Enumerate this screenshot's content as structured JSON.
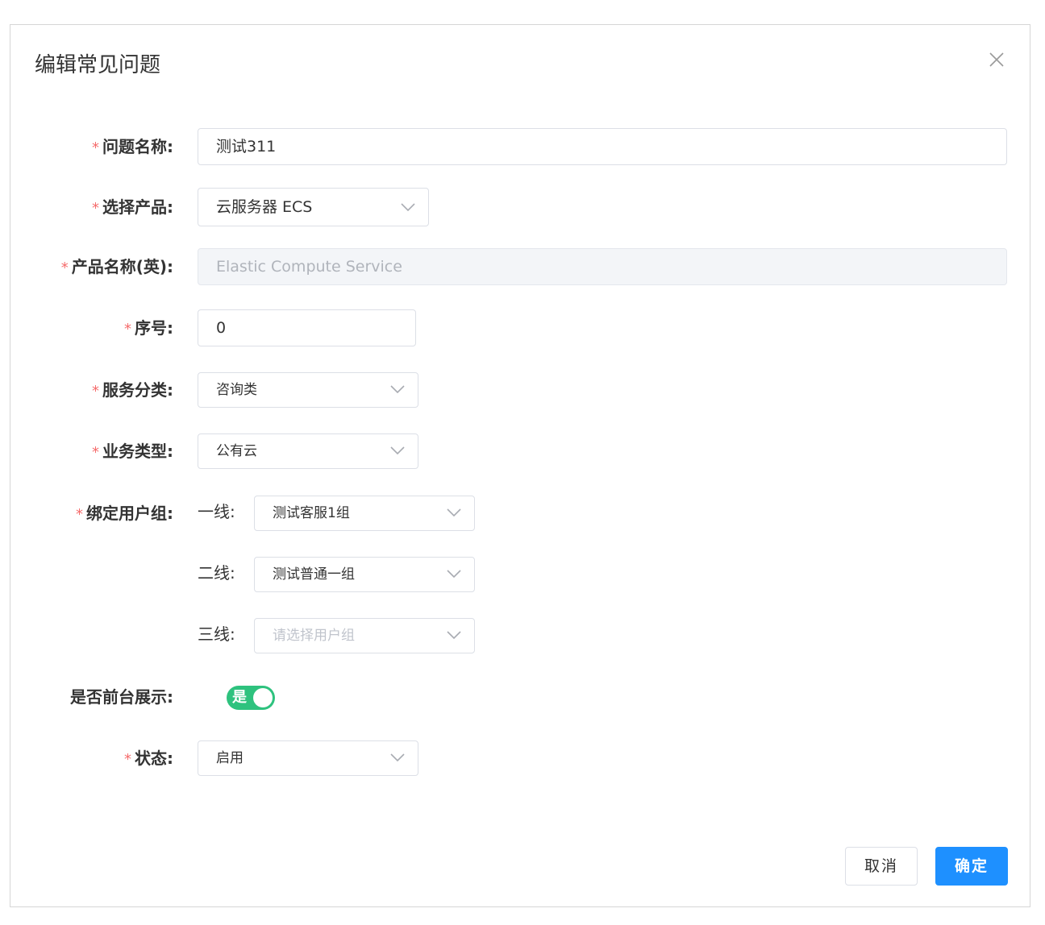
{
  "dialog": {
    "title": "编辑常见问题"
  },
  "fields": {
    "question_name": {
      "label": "问题名称:",
      "value": "测试311"
    },
    "product": {
      "label": "选择产品:",
      "value": "云服务器 ECS"
    },
    "product_en": {
      "label": "产品名称(英):",
      "value": "Elastic Compute Service"
    },
    "order": {
      "label": "序号:",
      "value": "0"
    },
    "service_category": {
      "label": "服务分类:",
      "value": "咨询类"
    },
    "business_type": {
      "label": "业务类型:",
      "value": "公有云"
    },
    "user_group": {
      "label": "绑定用户组:",
      "line1_label": "一线:",
      "line1_value": "测试客服1组",
      "line2_label": "二线:",
      "line2_value": "测试普通一组",
      "line3_label": "三线:",
      "line3_placeholder": "请选择用户组"
    },
    "show_front": {
      "label": "是否前台展示:",
      "switch_text": "是",
      "on": true
    },
    "status": {
      "label": "状态:",
      "value": "启用"
    }
  },
  "required_mark": "*",
  "footer": {
    "cancel_label": "取消",
    "ok_label": "确定"
  },
  "colors": {
    "primary": "#1e90ff",
    "switch_on": "#2ec27e",
    "required": "#f56c6c"
  },
  "icons": {
    "close": "close-icon",
    "chevron": "chevron-down-icon"
  }
}
